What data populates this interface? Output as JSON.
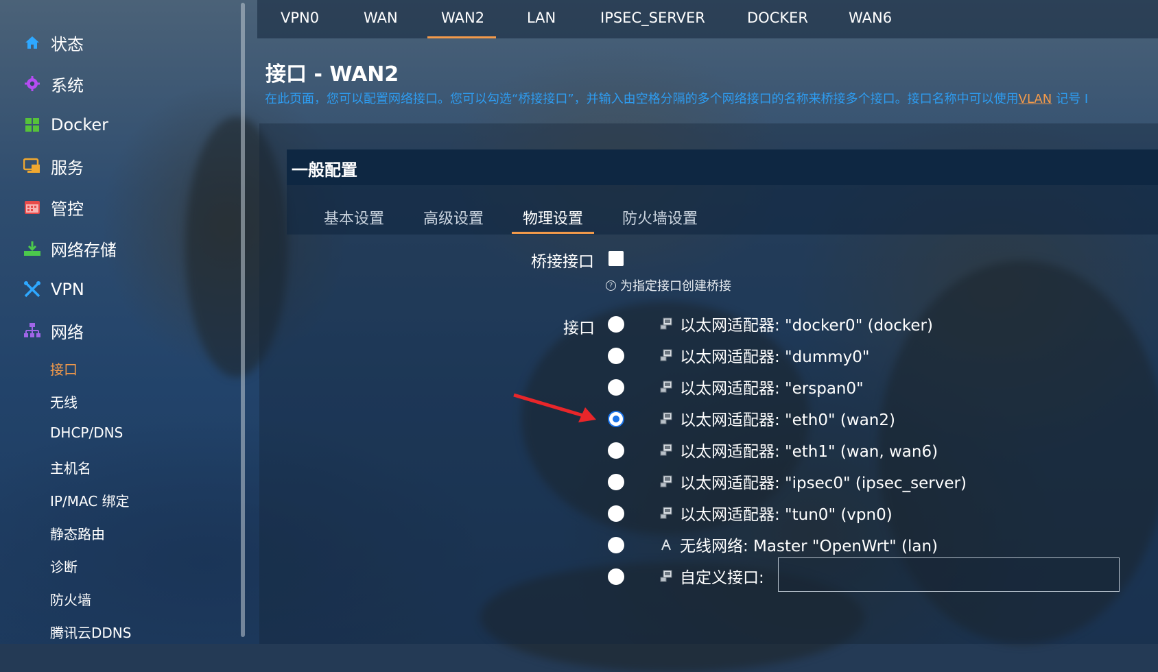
{
  "sidebar": {
    "items": [
      {
        "label": "状态",
        "icon": "home-icon"
      },
      {
        "label": "系统",
        "icon": "gear-icon"
      },
      {
        "label": "Docker",
        "icon": "docker-grid-icon"
      },
      {
        "label": "服务",
        "icon": "services-icon"
      },
      {
        "label": "管控",
        "icon": "calendar-icon"
      },
      {
        "label": "网络存储",
        "icon": "download-storage-icon"
      },
      {
        "label": "VPN",
        "icon": "vpn-icon"
      },
      {
        "label": "网络",
        "icon": "network-icon"
      }
    ],
    "subitems": [
      "接口",
      "无线",
      "DHCP/DNS",
      "主机名",
      "IP/MAC 绑定",
      "静态路由",
      "诊断",
      "防火墙",
      "腾讯云DDNS"
    ],
    "active_subitem": "接口"
  },
  "top_tabs": [
    "VPN0",
    "WAN",
    "WAN2",
    "LAN",
    "IPSEC_SERVER",
    "DOCKER",
    "WAN6"
  ],
  "active_top_tab": "WAN2",
  "page": {
    "title": "接口 - WAN2",
    "description": "在此页面，您可以配置网络接口。您可以勾选“桥接接口”，并输入由空格分隔的多个网络接口的名称来桥接多个接口。接口名称中可以使用",
    "description_link": "VLAN",
    "description_tail": "记号 I"
  },
  "section": {
    "title": "一般配置",
    "tabs": [
      "基本设置",
      "高级设置",
      "物理设置",
      "防火墙设置"
    ],
    "active_tab": "物理设置"
  },
  "form": {
    "bridge_label": "桥接接口",
    "bridge_checked": false,
    "bridge_help": "为指定接口创建桥接",
    "interface_label": "接口",
    "options": [
      {
        "label": "以太网适配器: \"docker0\" (docker)",
        "icon": "ethernet-icon",
        "checked": false
      },
      {
        "label": "以太网适配器: \"dummy0\"",
        "icon": "ethernet-icon",
        "checked": false
      },
      {
        "label": "以太网适配器: \"erspan0\"",
        "icon": "ethernet-icon",
        "checked": false
      },
      {
        "label": "以太网适配器: \"eth0\" (wan2)",
        "icon": "ethernet-icon",
        "checked": true
      },
      {
        "label": "以太网适配器: \"eth1\" (wan, wan6)",
        "icon": "ethernet-icon",
        "checked": false
      },
      {
        "label": "以太网适配器: \"ipsec0\" (ipsec_server)",
        "icon": "ethernet-icon",
        "checked": false
      },
      {
        "label": "以太网适配器: \"tun0\" (vpn0)",
        "icon": "ethernet-icon",
        "checked": false
      },
      {
        "label": "无线网络: Master \"OpenWrt\" (lan)",
        "icon": "wireless-icon",
        "checked": false
      },
      {
        "label": "自定义接口:",
        "icon": "ethernet-icon",
        "checked": false
      }
    ],
    "custom_value": ""
  },
  "colors": {
    "accent": "#f39a4a",
    "link": "#2e9cf0",
    "radio": "#1a73e8",
    "arrow": "#e8262a"
  }
}
